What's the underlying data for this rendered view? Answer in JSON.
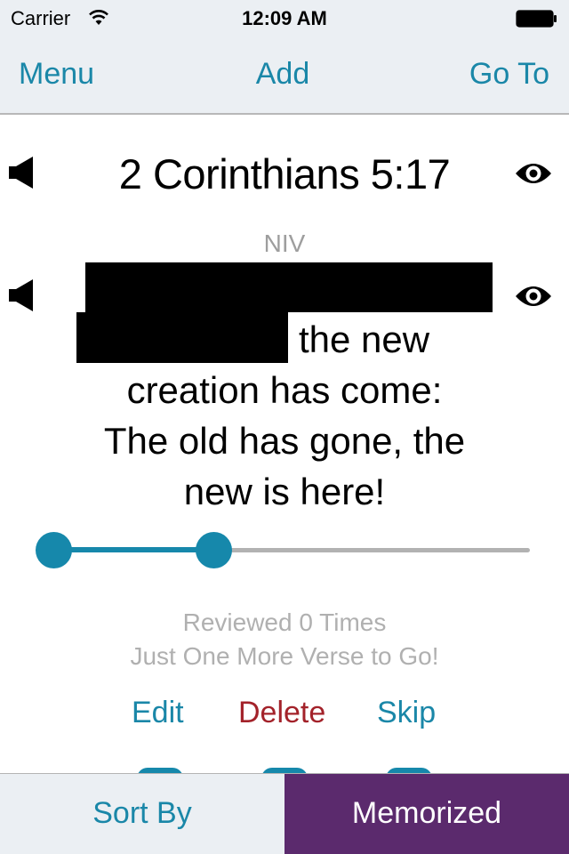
{
  "status_bar": {
    "carrier": "Carrier",
    "time": "12:09 AM",
    "wifi_icon": "wifi-icon",
    "battery_icon": "battery-full-icon"
  },
  "nav": {
    "left_label": "Menu",
    "center_label": "Add",
    "right_label": "Go To",
    "accent_color": "#1a87a8"
  },
  "verse_card": {
    "reference": "2 Corinthians 5:17",
    "version": "NIV",
    "verse_visible_text": {
      "line2_tail": "the new",
      "line3": "creation has come:",
      "line4": "The old has gone, the",
      "line5": "new is here!"
    },
    "redacted": true,
    "icons": {
      "reference_audio": "speaker-icon",
      "reference_reveal": "eye-icon",
      "verse_audio": "speaker-icon",
      "verse_reveal": "eye-icon"
    }
  },
  "progress_slider": {
    "steps_completed": 2,
    "value_fraction": 0.35,
    "active_color": "#1688ab",
    "inactive_color": "#b2b2b2"
  },
  "stats": {
    "reviewed": "Reviewed 0 Times",
    "remaining": "Just One More Verse to Go!"
  },
  "actions": {
    "edit": "Edit",
    "delete": "Delete",
    "skip": "Skip",
    "delete_color": "#a3222a"
  },
  "tab_bar": {
    "sort_label": "Sort By",
    "memorized_label": "Memorized",
    "memorized_color": "#5b2a6d"
  }
}
